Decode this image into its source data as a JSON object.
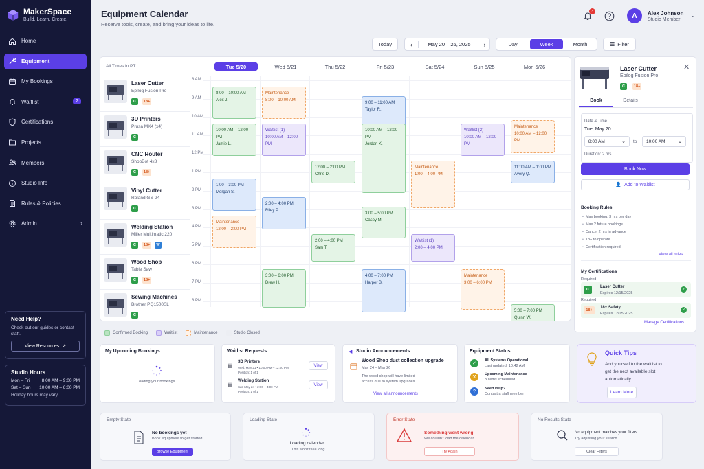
{
  "brand": {
    "title": "MakerSpace",
    "subtitle": "Build. Learn. Create."
  },
  "nav": [
    {
      "label": "Home",
      "icon": "home-icon"
    },
    {
      "label": "Equipment",
      "icon": "tools-icon",
      "active": true
    },
    {
      "label": "My Bookings",
      "icon": "calendar-icon"
    },
    {
      "label": "Waitlist",
      "icon": "bell-icon",
      "badge": "2"
    },
    {
      "label": "Certifications",
      "icon": "shield-icon"
    },
    {
      "label": "Projects",
      "icon": "folder-icon"
    },
    {
      "label": "Members",
      "icon": "users-icon"
    },
    {
      "label": "Studio Info",
      "icon": "info-icon"
    },
    {
      "label": "Rules & Policies",
      "icon": "document-icon"
    },
    {
      "label": "Admin",
      "icon": "gear-icon"
    }
  ],
  "help": {
    "title": "Need Help?",
    "text": "Check out our guides or contact staff.",
    "button": "View Resources"
  },
  "hours": {
    "title": "Studio Hours",
    "weekday_label": "Mon – Fri",
    "weekday_hours": "8:00 AM – 9:00 PM",
    "weekend_label": "Sat – Sun",
    "weekend_hours": "10:00 AM – 6:00 PM",
    "note": "Holiday hours may vary."
  },
  "header": {
    "title": "Equipment Calendar",
    "subtitle": "Reserve tools, create, and bring your ideas to life.",
    "notif_count": "3"
  },
  "user": {
    "initial": "A",
    "name": "Alex Johnson",
    "role": "Studio Member"
  },
  "toolbar": {
    "today": "Today",
    "range": "May 20 – 26, 2025",
    "views": [
      "Day",
      "Week",
      "Month"
    ],
    "active_view": "Week",
    "filter": "Filter"
  },
  "calendar": {
    "tz": "All Times in PT",
    "days": [
      "Tue  5/20",
      "Wed  5/21",
      "Thu  5/22",
      "Fri  5/23",
      "Sat  5/24",
      "Sun  5/25",
      "Mon  5/26"
    ],
    "times": [
      "8 AM",
      "9 AM",
      "10 AM",
      "11 AM",
      "12 PM",
      "1 PM",
      "2 PM",
      "3 PM",
      "4 PM",
      "5 PM",
      "6 PM",
      "7 PM",
      "8 PM"
    ],
    "equipment": [
      {
        "name": "Laser Cutter",
        "model": "Epilog Fusion Pro",
        "tags": [
          "C",
          "18+"
        ]
      },
      {
        "name": "3D Printers",
        "model": "Prusa MK4 (x4)",
        "tags": [
          "C"
        ]
      },
      {
        "name": "CNC Router",
        "model": "ShopBot 4x8",
        "tags": [
          "C",
          "18+"
        ]
      },
      {
        "name": "Vinyl Cutter",
        "model": "Roland GS-24",
        "tags": [
          "C"
        ]
      },
      {
        "name": "Welding Station",
        "model": "Miller Multimatic 220",
        "tags": [
          "C",
          "18+",
          "W"
        ]
      },
      {
        "name": "Wood Shop",
        "model": "Table Saw",
        "tags": [
          "C",
          "18+"
        ]
      },
      {
        "name": "Sewing Machines",
        "model": "Brother PQ1500SL",
        "tags": [
          "C"
        ]
      }
    ],
    "events": [
      {
        "type": "conf",
        "day": 0,
        "start": 8.0,
        "end": 9.75,
        "time": "8:00 – 10:00 AM",
        "who": "Alex J."
      },
      {
        "type": "maint",
        "day": 1,
        "start": 8.0,
        "end": 9.75,
        "time": "8:00 – 10:00 AM",
        "who": "Maintenance"
      },
      {
        "type": "book",
        "day": 3,
        "start": 8.5,
        "end": 10.25,
        "time": "9:00 – 11:00 AM",
        "who": "Taylor R."
      },
      {
        "type": "conf",
        "day": 0,
        "start": 10.0,
        "end": 11.75,
        "time": "10:00 AM – 12:00 PM",
        "who": "Jamie L."
      },
      {
        "type": "wait",
        "day": 1,
        "start": 10.0,
        "end": 11.75,
        "time": "10:00 AM – 12:00 PM",
        "who": "Waitlist (1)"
      },
      {
        "type": "conf",
        "day": 3,
        "start": 10.0,
        "end": 13.75,
        "time": "10:00 AM – 12:00 PM",
        "who": "Jordan K."
      },
      {
        "type": "wait",
        "day": 5,
        "start": 10.0,
        "end": 11.75,
        "time": "10:00 AM – 12:00 PM",
        "who": "Waitlist (2)"
      },
      {
        "type": "maint",
        "day": 6,
        "start": 9.8,
        "end": 11.6,
        "time": "10:00 AM – 12:00 PM",
        "who": "Maintenance"
      },
      {
        "type": "conf",
        "day": 2,
        "start": 12.0,
        "end": 13.25,
        "time": "12:00 – 2:00 PM",
        "who": "Chris D."
      },
      {
        "type": "maint",
        "day": 4,
        "start": 12.0,
        "end": 14.6,
        "time": "1:00 – 4:00 PM",
        "who": "Maintenance"
      },
      {
        "type": "book",
        "day": 6,
        "start": 12.0,
        "end": 13.25,
        "time": "11:00 AM – 1:00 PM",
        "who": "Avery Q."
      },
      {
        "type": "book",
        "day": 0,
        "start": 13.0,
        "end": 14.75,
        "time": "1:00 – 3:00 PM",
        "who": "Morgan S."
      },
      {
        "type": "book",
        "day": 1,
        "start": 14.0,
        "end": 15.75,
        "time": "2:00 – 4:00 PM",
        "who": "Riley P."
      },
      {
        "type": "maint",
        "day": 0,
        "start": 15.0,
        "end": 16.75,
        "time": "12:00 – 2:00 PM",
        "who": "Maintenance"
      },
      {
        "type": "conf",
        "day": 3,
        "start": 14.5,
        "end": 16.25,
        "time": "3:00 – 5:00 PM",
        "who": "Casey M."
      },
      {
        "type": "conf",
        "day": 2,
        "start": 16.0,
        "end": 17.5,
        "time": "2:00 – 4:00 PM",
        "who": "Sam T."
      },
      {
        "type": "wait",
        "day": 4,
        "start": 16.0,
        "end": 17.5,
        "time": "2:00 – 4:00 PM",
        "who": "Waitlist (1)"
      },
      {
        "type": "conf",
        "day": 1,
        "start": 17.9,
        "end": 20.0,
        "time": "3:00 – 6:00 PM",
        "who": "Drew H."
      },
      {
        "type": "book",
        "day": 3,
        "start": 17.9,
        "end": 20.25,
        "time": "4:00 – 7:00 PM",
        "who": "Harper B."
      },
      {
        "type": "maint",
        "day": 5,
        "start": 17.9,
        "end": 20.1,
        "time": "3:00 – 6:00 PM",
        "who": "Maintenance"
      },
      {
        "type": "conf",
        "day": 6,
        "start": 19.8,
        "end": 21.0,
        "time": "5:00 – 7:00 PM",
        "who": "Quinn W."
      }
    ],
    "legend": [
      "Confirmed Booking",
      "Waitlist",
      "Maintenance",
      "Studio Closed"
    ]
  },
  "panel": {
    "title": "Laser Cutter",
    "model": "Epilog Fusion Pro",
    "tags": [
      "C",
      "18+"
    ],
    "tabs": [
      "Book",
      "Details"
    ],
    "datetime_label": "Date & Time",
    "date": "Tue, May 20",
    "start": "8:00 AM",
    "to": "to",
    "end": "10:00 AM",
    "duration": "Duration: 2 hrs",
    "book_now": "Book Now",
    "add_waitlist": "Add to Waitlist",
    "rules_title": "Booking Rules",
    "rules": [
      "Max booking: 3 hrs per day",
      "Max 2 future bookings",
      "Cancel 2 hrs in advance",
      "18+ to operate",
      "Certification required"
    ],
    "view_rules": "View all rules",
    "certs_title": "My Certifications",
    "cert1_req": "Required",
    "cert1_badge": "C",
    "cert1_name": "Laser Cutter",
    "cert1_exp": "Expires 12/15/2025",
    "cert2_req": "Required",
    "cert2_badge": "18+",
    "cert2_name": "18+ Safety",
    "cert2_exp": "Expires 12/15/2025",
    "manage": "Manage Certifications"
  },
  "upcoming": {
    "title": "My Upcoming Bookings",
    "loading": "Loading your bookings..."
  },
  "waitlist": {
    "title": "Waitlist Requests",
    "items": [
      {
        "name": "3D Printers",
        "detail": "Wed, May 21 • 10:00 AM – 12:00 PM",
        "position": "Position: 1 of 1",
        "action": "View"
      },
      {
        "name": "Welding Station",
        "detail": "Sat, May 24 • 2:00 – 4:00 PM",
        "position": "Position: 1 of 1",
        "action": "View"
      }
    ]
  },
  "announce": {
    "title": "Studio Announcements",
    "headline": "Wood Shop dust collection upgrade",
    "dates": "May 24 – May 26",
    "body": "The wood shop will have limited access due to system upgrades.",
    "link": "View all announcements"
  },
  "status": {
    "title": "Equipment Status",
    "items": [
      {
        "label": "All Systems Operational",
        "sub": "Last updated: 10:42 AM",
        "color": "#2e9e4a"
      },
      {
        "label": "Upcoming Maintenance",
        "sub": "3 items scheduled",
        "color": "#e0a21a"
      },
      {
        "label": "Need Help?",
        "sub": "Contact a staff member",
        "color": "#2f6fd6"
      }
    ]
  },
  "tips": {
    "title": "Quick Tips",
    "body": "Add yourself to the waitlist to get the next available slot automatically.",
    "button": "Learn More"
  },
  "states": {
    "empty": {
      "title": "Empty State",
      "head": "No bookings yet",
      "sub": "Book equipment to get started",
      "button": "Browse Equipment"
    },
    "loading": {
      "title": "Loading State",
      "head": "Loading calendar...",
      "sub": "This won't take long."
    },
    "error": {
      "title": "Error State",
      "head": "Something went wrong",
      "sub": "We couldn't load the calendar.",
      "button": "Try Again"
    },
    "noresults": {
      "title": "No Results State",
      "head": "No equipment matches your filters.",
      "sub": "Try adjusting your search.",
      "button": "Clear Filters"
    }
  },
  "colors": {
    "accent": "#5b3fe6",
    "sidebar": "#151838",
    "confirmed": "#e4f4e6",
    "waitlist": "#ece7fb",
    "maintenance": "#fff3e8",
    "closed": "#eceef3"
  }
}
